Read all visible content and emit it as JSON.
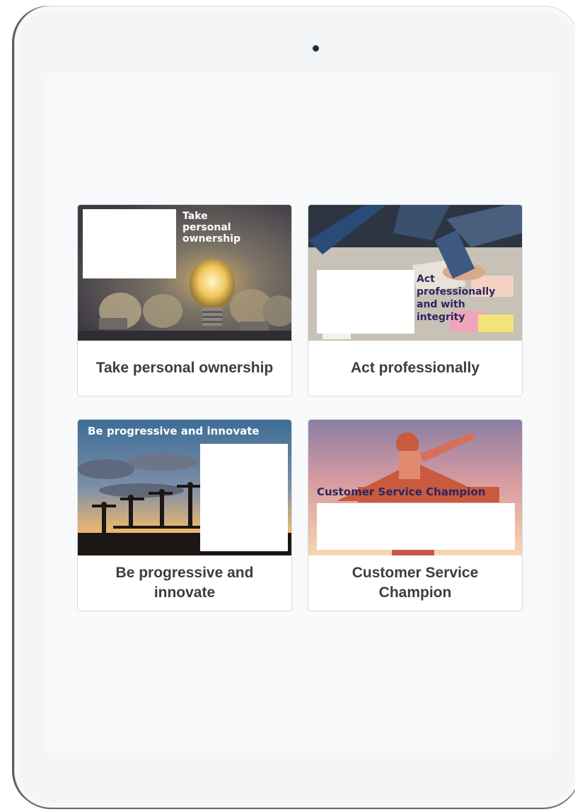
{
  "cards": [
    {
      "label": "Take personal ownership",
      "overlay": [
        "Take",
        "personal",
        "ownership"
      ],
      "image": "light-bulbs-image"
    },
    {
      "label": "Act professionally",
      "overlay": [
        "Act",
        "professionally",
        "and with",
        "integrity"
      ],
      "image": "desk-meeting-image"
    },
    {
      "label": "Be progressive and innovate",
      "overlay": [
        "Be progressive and innovate"
      ],
      "image": "sunset-builders-image"
    },
    {
      "label": "Customer Service Champion",
      "overlay": [
        "Customer Service Champion"
      ],
      "image": "superhero-image"
    }
  ],
  "colors": {
    "card_label": "#3b3d40",
    "overlay_dark": "#2b2660",
    "overlay_light": "#ffffff"
  }
}
